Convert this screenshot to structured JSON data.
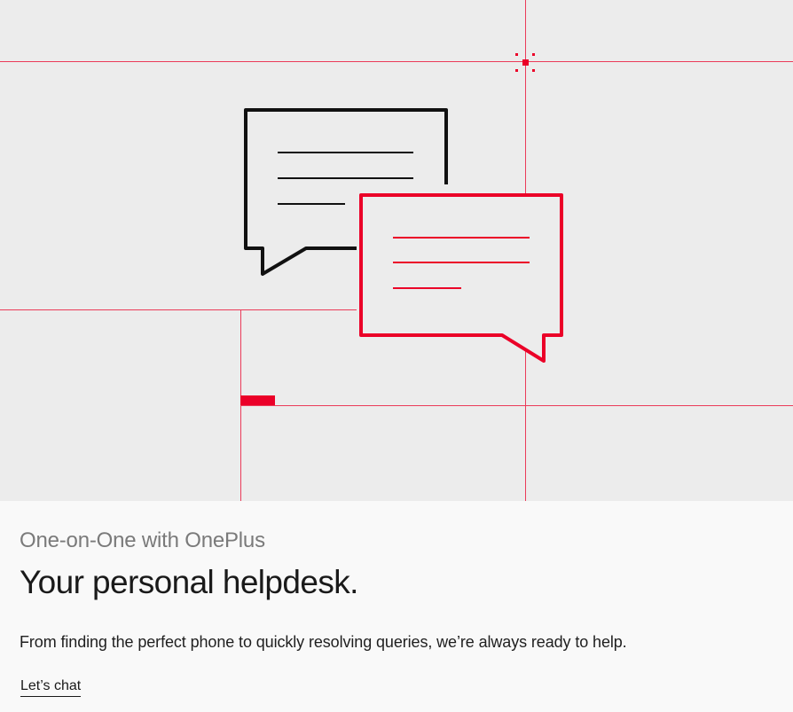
{
  "colors": {
    "accent": "#eb0028",
    "hero_background": "#ececec",
    "card_background": "#f9f9f9",
    "eyebrow_text": "#7a7a7a",
    "title_text": "#1a1a1a"
  },
  "hero": {
    "illustration": {
      "back_bubble_icon": "chat-bubble-icon",
      "front_bubble_icon": "chat-bubble-icon",
      "decoration": "grid-lines"
    }
  },
  "content": {
    "eyebrow": "One-on-One with OnePlus",
    "title": "Your personal helpdesk.",
    "description": "From finding the perfect phone to quickly resolving queries, we’re always ready to help.",
    "cta_label": "Let’s chat"
  }
}
